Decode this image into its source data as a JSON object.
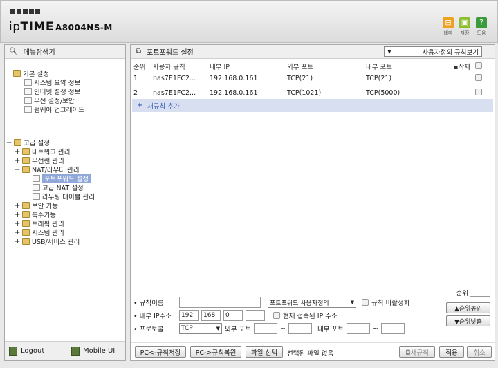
{
  "header": {
    "brand_light": "ip",
    "brand_bold": "TIME",
    "model": "A8004NS-M",
    "buttons": [
      {
        "label": "테마",
        "icon": "theme-icon",
        "color": "#f0a020"
      },
      {
        "label": "저장",
        "icon": "save-icon",
        "color": "#8cbf30"
      },
      {
        "label": "도움",
        "icon": "help-icon",
        "color": "#3b9a3b"
      }
    ]
  },
  "sidebar": {
    "title": "메뉴탐색기",
    "basic": {
      "label": "기본 설정",
      "items": [
        "시스템 요약 정보",
        "인터넷 설정 정보",
        "무선 설정/보안",
        "펌웨어 업그레이드"
      ]
    },
    "advanced": {
      "label": "고급 설정",
      "items": [
        {
          "toggle": "+",
          "label": "네트워크 관리"
        },
        {
          "toggle": "+",
          "label": "무선랜 관리"
        },
        {
          "toggle": "−",
          "label": "NAT/라우터 관리"
        },
        {
          "toggle": "+",
          "label": "보안 기능"
        },
        {
          "toggle": "+",
          "label": "특수기능"
        },
        {
          "toggle": "+",
          "label": "트래픽 관리"
        },
        {
          "toggle": "+",
          "label": "시스템 관리"
        },
        {
          "toggle": "+",
          "label": "USB/서비스 관리"
        }
      ],
      "nat_children": [
        "포트포워드 설정",
        "고급 NAT 설정",
        "라우팅 테이블 관리"
      ]
    },
    "logout": "Logout",
    "mobile": "Mobile UI"
  },
  "main": {
    "title": "포트포워드 설정",
    "view_select": "사용자정의 규칙보기",
    "columns": [
      "순위",
      "사용자 규칙",
      "내부 IP",
      "외부 포트",
      "내부 포트",
      "삭제"
    ],
    "rows": [
      {
        "rank": "1",
        "rule": "nas7E1FC2...",
        "ip": "192.168.0.161",
        "ext": "TCP(21)",
        "int": "TCP(21)"
      },
      {
        "rank": "2",
        "rule": "nas7E1FC2...",
        "ip": "192.168.0.161",
        "ext": "TCP(1021)",
        "int": "TCP(5000)"
      }
    ],
    "add_rule": "새규칙 추가"
  },
  "form": {
    "rule_name_label": "규칙이름",
    "rule_type": "포트포워드 사용자정의",
    "disable_label": "규칙 비활성화",
    "ip_label": "내부 IP주소",
    "ip": [
      "192",
      "168",
      "0",
      ""
    ],
    "current_ip_label": "현재 접속된 IP 주소",
    "protocol_label": "프로토콜",
    "protocol": "TCP",
    "ext_port_label": "외부 포트",
    "int_port_label": "내부 포트",
    "tilde": "~",
    "rank_label": "순위",
    "rank_up": "▲순위높임",
    "rank_down": "▼순위낮춤"
  },
  "bottom": {
    "save_pc": "PC<-규칙저장",
    "restore_pc": "PC->규칙복원",
    "file_select": "파일 선택",
    "file_status": "선택된 파일 없음",
    "new_rule": "◘새규칙",
    "apply": "적용",
    "cancel": "취소"
  }
}
